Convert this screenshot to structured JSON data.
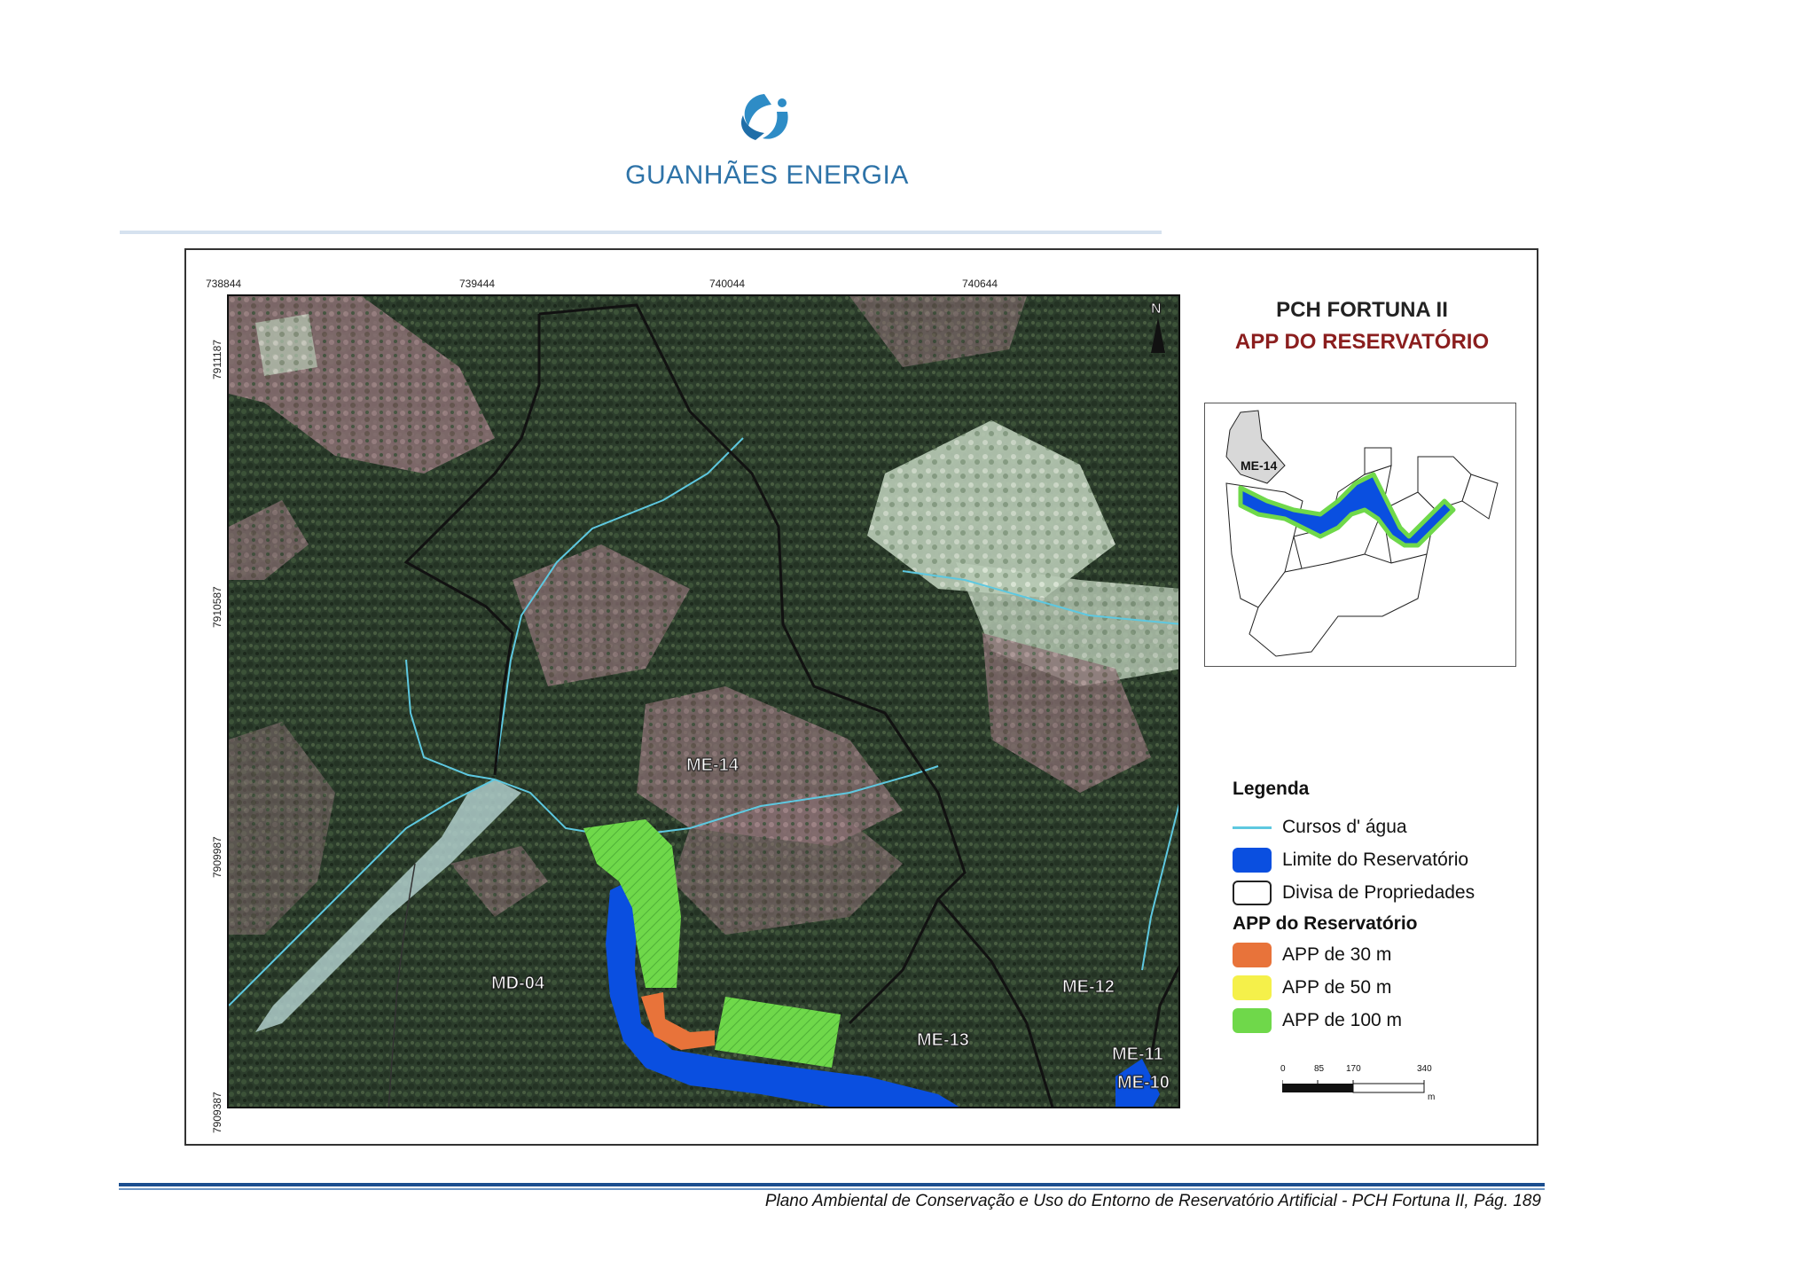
{
  "header": {
    "logo_text": "GUANHÃES ENERGIA",
    "brand_color": "#2e73a8"
  },
  "map": {
    "title": "PCH FORTUNA II",
    "subtitle": "APP DO RESERVATÓRIO",
    "coords_x": [
      "738844",
      "739444",
      "740044",
      "740644"
    ],
    "coords_y": [
      "7911187",
      "7910587",
      "7909987",
      "7909387"
    ],
    "north_label": "N",
    "property_labels": [
      "ME-14",
      "MD-04",
      "ME-13",
      "ME-12",
      "ME-11",
      "ME-10"
    ],
    "inset_label": "ME-14"
  },
  "legend": {
    "title": "Legenda",
    "items": [
      {
        "label": "Cursos d' água",
        "color": "#5ec8e0",
        "icon": "line"
      },
      {
        "label": "Limite do Reservatório",
        "color": "#0a4fe0",
        "icon": "fill"
      },
      {
        "label": "Divisa de Propriedades",
        "color": "#ffffff",
        "icon": "outline"
      }
    ],
    "app_title": "APP do Reservatório",
    "app_items": [
      {
        "label": "APP de 30 m",
        "color": "#e8733a"
      },
      {
        "label": "APP de 50 m",
        "color": "#f5f04a"
      },
      {
        "label": "APP de 100 m",
        "color": "#6fd84a"
      }
    ]
  },
  "scale": {
    "ticks": [
      "0",
      "85",
      "170",
      "340"
    ],
    "unit": "m"
  },
  "footer": {
    "text": "Plano Ambiental de Conservação e Uso do Entorno de Reservatório Artificial - PCH Fortuna II, Pág. 189"
  }
}
